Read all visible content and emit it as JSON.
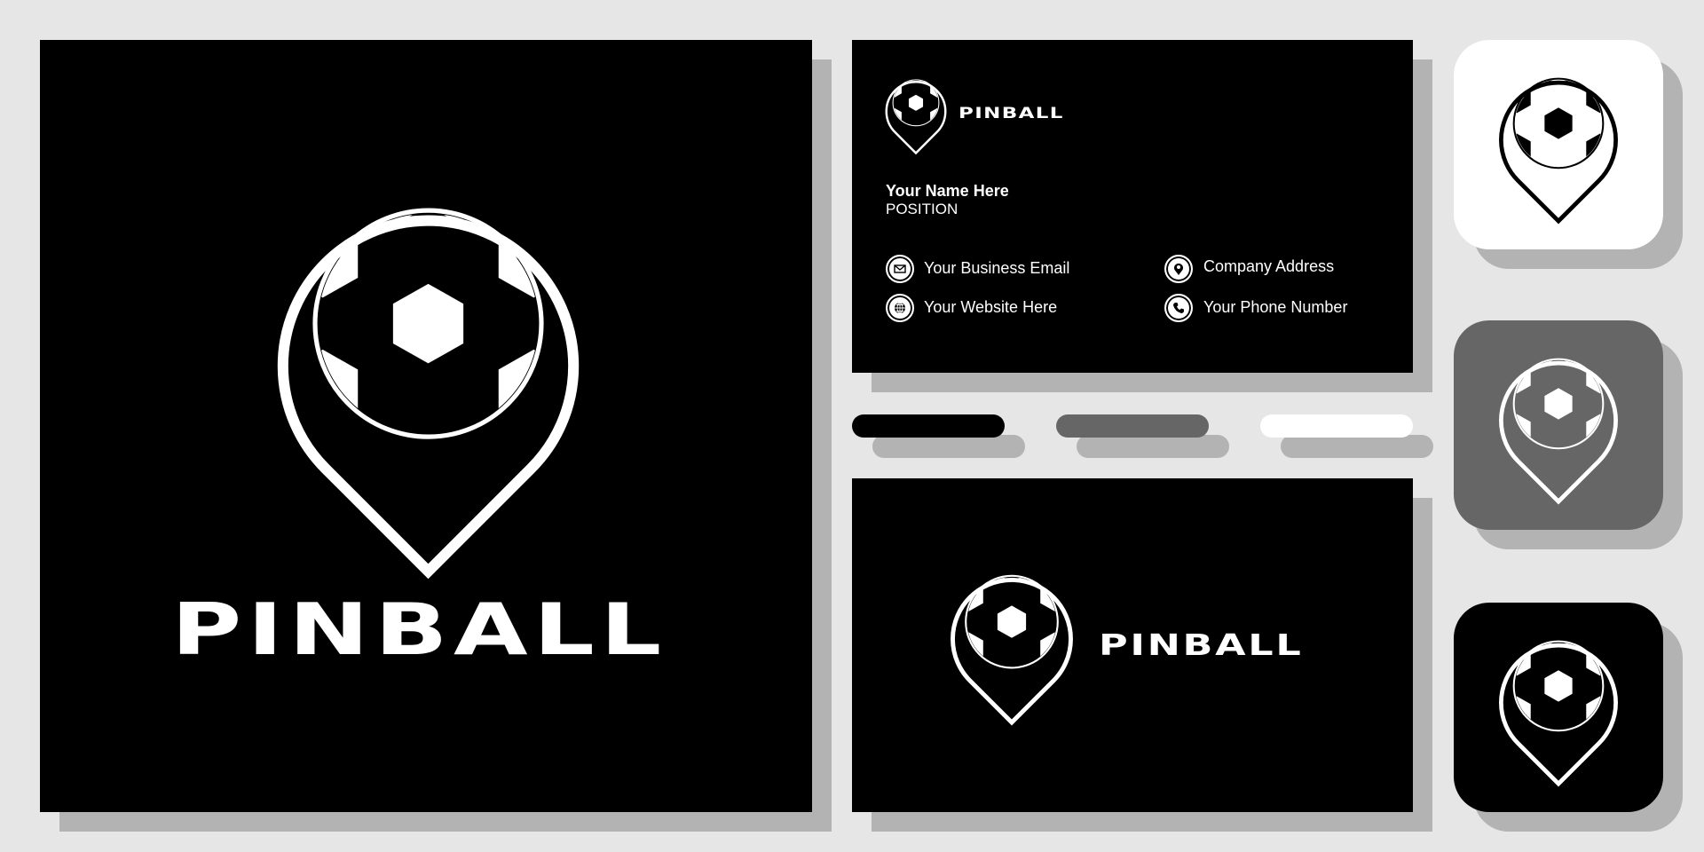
{
  "brand": {
    "name": "PINBALL",
    "colors": {
      "background": "#e6e6e6",
      "shadow": "#b3b3b3",
      "black": "#000000",
      "gray": "#666666",
      "white": "#ffffff"
    }
  },
  "main_logo": {
    "wordmark": "PINBALL",
    "icon": "soccer-ball-location-pin-icon"
  },
  "business_card_front": {
    "wordmark": "PINBALL",
    "name": "Your Name Here",
    "position": "POSITION",
    "contacts": [
      {
        "icon": "email-icon",
        "label": "Your Business Email"
      },
      {
        "icon": "globe-icon",
        "label": "Your Website Here"
      },
      {
        "icon": "location-pin-icon",
        "label": "Company Address"
      },
      {
        "icon": "phone-icon",
        "label": "Your Phone Number"
      }
    ]
  },
  "business_card_back": {
    "wordmark": "PINBALL"
  },
  "color_swatches": [
    {
      "name": "black",
      "color": "#000000"
    },
    {
      "name": "gray",
      "color": "#666666"
    },
    {
      "name": "white",
      "color": "#ffffff"
    }
  ],
  "app_icons": [
    {
      "variant": "white",
      "background": "#ffffff",
      "foreground": "#000000"
    },
    {
      "variant": "gray",
      "background": "#666666",
      "foreground": "#ffffff"
    },
    {
      "variant": "black",
      "background": "#000000",
      "foreground": "#ffffff"
    }
  ]
}
